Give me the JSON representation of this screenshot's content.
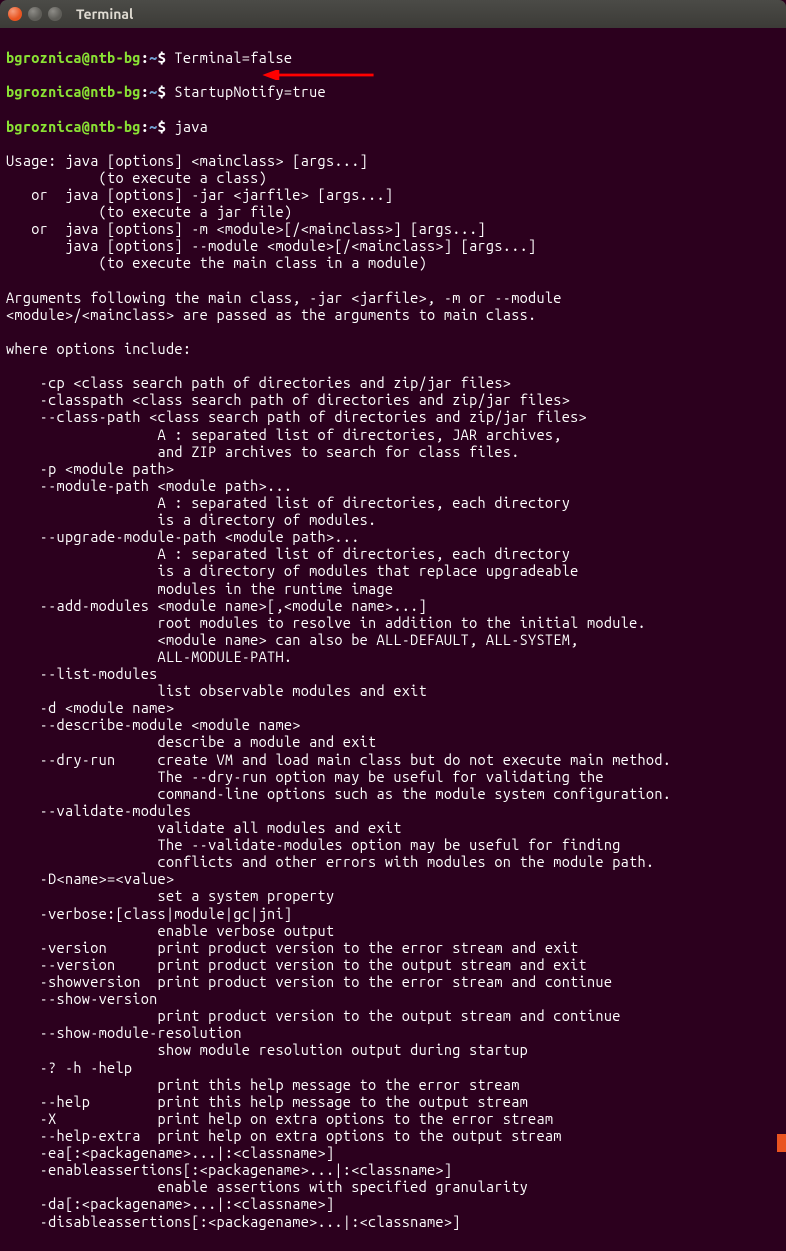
{
  "window": {
    "title": "Terminal"
  },
  "prompt": {
    "user_host": "bgroznica@ntb-bg",
    "colon": ":",
    "path": "~",
    "dollar": "$ "
  },
  "cmds": {
    "c1": "Terminal=false",
    "c2": "StartupNotify=true",
    "c3": "java"
  },
  "out": [
    "Usage: java [options] <mainclass> [args...]",
    "           (to execute a class)",
    "   or  java [options] -jar <jarfile> [args...]",
    "           (to execute a jar file)",
    "   or  java [options] -m <module>[/<mainclass>] [args...]",
    "       java [options] --module <module>[/<mainclass>] [args...]",
    "           (to execute the main class in a module)",
    "",
    "Arguments following the main class, -jar <jarfile>, -m or --module",
    "<module>/<mainclass> are passed as the arguments to main class.",
    "",
    "where options include:",
    "",
    "    -cp <class search path of directories and zip/jar files>",
    "    -classpath <class search path of directories and zip/jar files>",
    "    --class-path <class search path of directories and zip/jar files>",
    "                  A : separated list of directories, JAR archives,",
    "                  and ZIP archives to search for class files.",
    "    -p <module path>",
    "    --module-path <module path>...",
    "                  A : separated list of directories, each directory",
    "                  is a directory of modules.",
    "    --upgrade-module-path <module path>...",
    "                  A : separated list of directories, each directory",
    "                  is a directory of modules that replace upgradeable",
    "                  modules in the runtime image",
    "    --add-modules <module name>[,<module name>...]",
    "                  root modules to resolve in addition to the initial module.",
    "                  <module name> can also be ALL-DEFAULT, ALL-SYSTEM,",
    "                  ALL-MODULE-PATH.",
    "    --list-modules",
    "                  list observable modules and exit",
    "    -d <module name>",
    "    --describe-module <module name>",
    "                  describe a module and exit",
    "    --dry-run     create VM and load main class but do not execute main method.",
    "                  The --dry-run option may be useful for validating the",
    "                  command-line options such as the module system configuration.",
    "    --validate-modules",
    "                  validate all modules and exit",
    "                  The --validate-modules option may be useful for finding",
    "                  conflicts and other errors with modules on the module path.",
    "    -D<name>=<value>",
    "                  set a system property",
    "    -verbose:[class|module|gc|jni]",
    "                  enable verbose output",
    "    -version      print product version to the error stream and exit",
    "    --version     print product version to the output stream and exit",
    "    -showversion  print product version to the error stream and continue",
    "    --show-version",
    "                  print product version to the output stream and continue",
    "    --show-module-resolution",
    "                  show module resolution output during startup",
    "    -? -h -help",
    "                  print this help message to the error stream",
    "    --help        print this help message to the output stream",
    "    -X            print help on extra options to the error stream",
    "    --help-extra  print help on extra options to the output stream",
    "    -ea[:<packagename>...|:<classname>]",
    "    -enableassertions[:<packagename>...|:<classname>]",
    "                  enable assertions with specified granularity",
    "    -da[:<packagename>...|:<classname>]",
    "    -disableassertions[:<packagename>...|:<classname>]"
  ]
}
